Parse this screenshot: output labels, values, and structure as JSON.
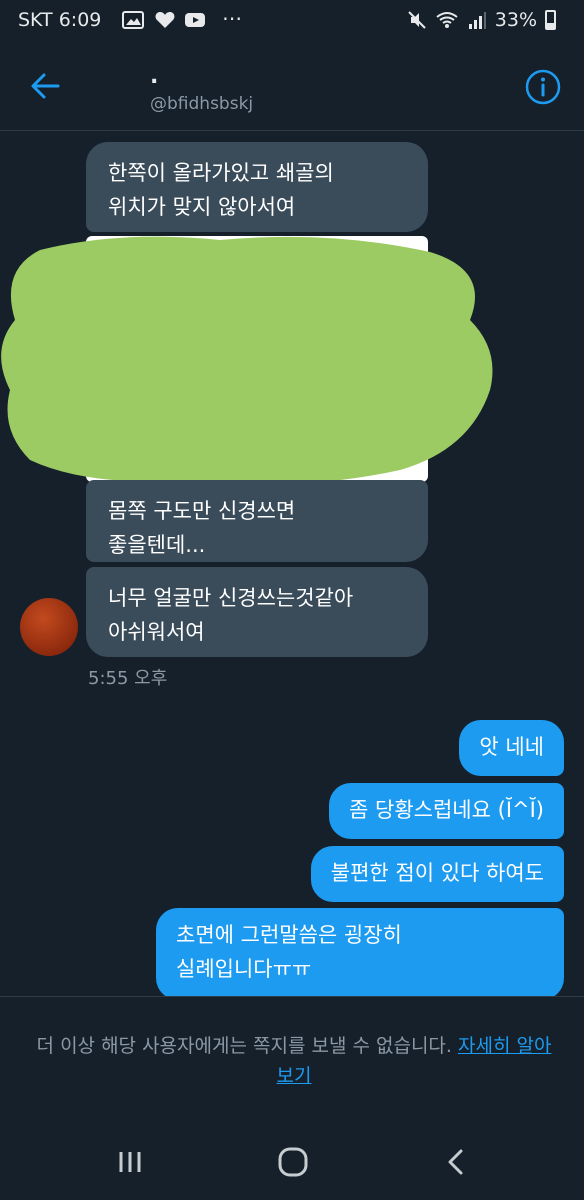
{
  "status_bar": {
    "carrier": "SKT",
    "time": "6:09",
    "battery": "33%",
    "overflow": "⋯"
  },
  "header": {
    "name": ".",
    "handle": "@bfidhsbskj"
  },
  "messages_in": [
    {
      "text": "한쪽이 올라가있고 쇄골의\n위치가 맞지 않아서여"
    },
    {
      "text": "몸쪽 구도만 신경쓰면\n좋을텐데..."
    },
    {
      "text": "너무 얼굴만 신경쓰는것같아\n아쉬워서여"
    }
  ],
  "timestamp": "5:55 오후",
  "messages_out": [
    {
      "text": "앗 네네"
    },
    {
      "text": "좀 당황스럽네요 (Ĭ^Ĭ)"
    },
    {
      "text": "불편한 점이 있다 하여도"
    },
    {
      "text": "초면에 그런말씀은 굉장히\n실례입니다ㅠㅠ"
    }
  ],
  "footer": {
    "notice": "더 이상 해당 사용자에게는 쪽지를 보낼 수 없습니다.",
    "link": "자세히 알아보기"
  },
  "colors": {
    "background": "#15202b",
    "incoming_bubble": "#3a4b5a",
    "outgoing_bubble": "#1d9bf0",
    "accent": "#1d9bf0",
    "scribble": "#9ccb63"
  },
  "icons": [
    "back-arrow-icon",
    "info-icon",
    "recent-apps-icon",
    "home-icon",
    "back-nav-icon",
    "wifi-icon",
    "signal-icon",
    "mute-icon",
    "gallery-icon",
    "heart-icon",
    "youtube-icon"
  ]
}
